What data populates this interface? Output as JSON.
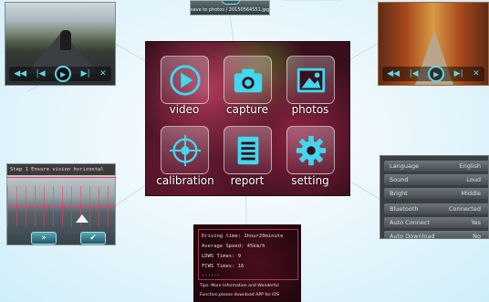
{
  "top_strip": {
    "caption": "save to photos / 20150564551.jpg"
  },
  "main_menu": {
    "items": [
      {
        "label": "video",
        "icon": "play-icon"
      },
      {
        "label": "capture",
        "icon": "camera-icon"
      },
      {
        "label": "photos",
        "icon": "image-icon"
      },
      {
        "label": "calibration",
        "icon": "crosshair-icon"
      },
      {
        "label": "report",
        "icon": "document-icon"
      },
      {
        "label": "setting",
        "icon": "gear-icon"
      }
    ],
    "accent": "#3fd8ee"
  },
  "video_player": {
    "controls": [
      "rewind-icon",
      "prev-icon",
      "play-icon",
      "next-icon",
      "close-icon"
    ]
  },
  "photo_viewer": {
    "controls": [
      "rewind-icon",
      "prev-icon",
      "play-icon",
      "next-icon",
      "close-icon"
    ]
  },
  "calibration": {
    "instruction": "Step 1 Ensure vision horizontal"
  },
  "report": {
    "lines": [
      "Driving time: 1hour20minute",
      "Average Speed: 45km/h",
      "LDWS Times: 9",
      "FCWS Times: 16",
      "......"
    ],
    "tip_line1": "Tips: More Information and Wonderful",
    "tip_line2": "Function,please download APP for IOS"
  },
  "settings": {
    "rows": [
      {
        "key": "Language",
        "value": "English"
      },
      {
        "key": "Sound",
        "value": "Loud"
      },
      {
        "key": "Bright",
        "value": "Middle"
      },
      {
        "key": "Bluetooth",
        "value": "Connected"
      },
      {
        "key": "Auto Connect",
        "value": "Yes"
      },
      {
        "key": "Auto Download",
        "value": "No"
      }
    ]
  }
}
